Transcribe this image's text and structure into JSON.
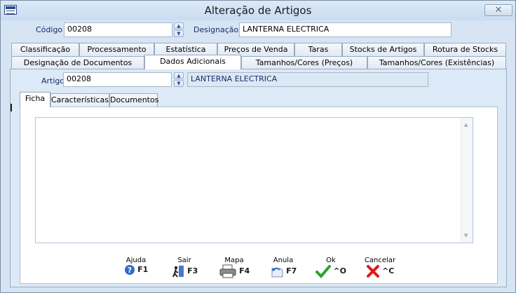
{
  "window": {
    "title": "Alteração de Artigos",
    "close_glyph": "✕"
  },
  "header": {
    "codigo_label": "Código",
    "codigo_value": "00208",
    "designacao_label": "Designação",
    "designacao_value": "LANTERNA ELECTRICA"
  },
  "tabs_row1": [
    "Classificação",
    "Processamento",
    "Estatística",
    "Preços de Venda",
    "Taras",
    "Stocks de Artigos",
    "Rotura de Stocks"
  ],
  "tabs_row2": [
    "Designação de Documentos",
    "Dados Adicionais",
    "Tamanhos/Cores (Preços)",
    "Tamanhos/Cores (Existências)"
  ],
  "active_tab": "Dados Adicionais",
  "artigo": {
    "label": "Artigo",
    "value": "00208",
    "name": "LANTERNA ELECTRICA"
  },
  "subtabs": [
    "Ficha",
    "Características",
    "Documentos"
  ],
  "active_subtab": "Ficha",
  "footer": {
    "ajuda": {
      "caption": "Ajuda",
      "key": "F1"
    },
    "sair": {
      "caption": "Sair",
      "key": "F3"
    },
    "mapa": {
      "caption": "Mapa",
      "key": "F4"
    },
    "anula": {
      "caption": "Anula",
      "key": "F7"
    },
    "ok": {
      "caption": "Ok",
      "key": "^O"
    },
    "cancelar": {
      "caption": "Cancelar",
      "key": "^C"
    }
  },
  "icons": {
    "app": "app-icon",
    "help": "help-icon",
    "exit": "exit-icon",
    "print": "printer-icon",
    "undo": "undo-icon",
    "ok": "check-icon",
    "cancel": "cross-icon"
  },
  "colors": {
    "accent": "#1a2a6c",
    "ok": "#2aa52a",
    "cancel": "#e01818"
  }
}
